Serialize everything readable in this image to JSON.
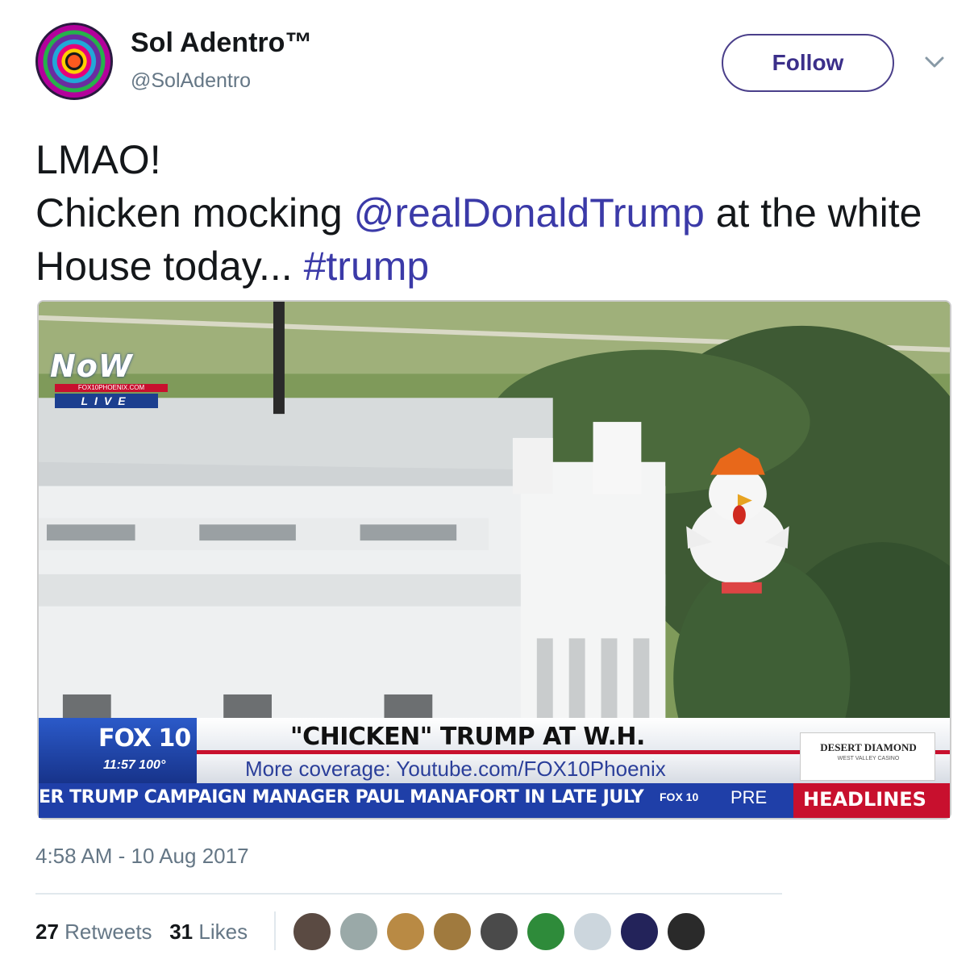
{
  "author": {
    "name": "Sol Adentro™",
    "handle": "@SolAdentro"
  },
  "actions": {
    "follow_label": "Follow",
    "more_icon": "chevron-down-icon"
  },
  "tweet": {
    "line1": "LMAO!",
    "text_before_mention": "Chicken mocking ",
    "mention": "@realDonaldTrump",
    "text_after_mention": " at the white House today... ",
    "hashtag": "#trump"
  },
  "media": {
    "logo_now": "NoW",
    "logo_site": "FOX10PHOENIX.COM",
    "logo_live": "LIVE",
    "channel": "FOX 10",
    "time_temp": "11:57 100°",
    "headline": "\"CHICKEN\" TRUMP AT W.H.",
    "coverage": "More coverage: Youtube.com/FOX10Phoenix",
    "sponsor": "DESERT DIAMOND",
    "sponsor_sub": "WEST VALLEY CASINO",
    "ticker": "ER TRUMP CAMPAIGN MANAGER PAUL MANAFORT IN LATE JULY",
    "ticker_logo": "FOX 10",
    "ticker_pre": "PRE",
    "headlines_label": "HEADLINES"
  },
  "timestamp": "4:58 AM - 10 Aug 2017",
  "stats": {
    "retweets_count": "27",
    "retweets_label": "Retweets",
    "likes_count": "31",
    "likes_label": "Likes"
  },
  "likers": [
    {
      "color": "#5a4a42"
    },
    {
      "color": "#9aa9a8"
    },
    {
      "color": "#b98a44"
    },
    {
      "color": "#a07a3e"
    },
    {
      "color": "#4a4a4a"
    },
    {
      "color": "#2e8b3a"
    },
    {
      "color": "#ccd6dd"
    },
    {
      "color": "#23235a"
    },
    {
      "color": "#2a2a2a"
    }
  ]
}
